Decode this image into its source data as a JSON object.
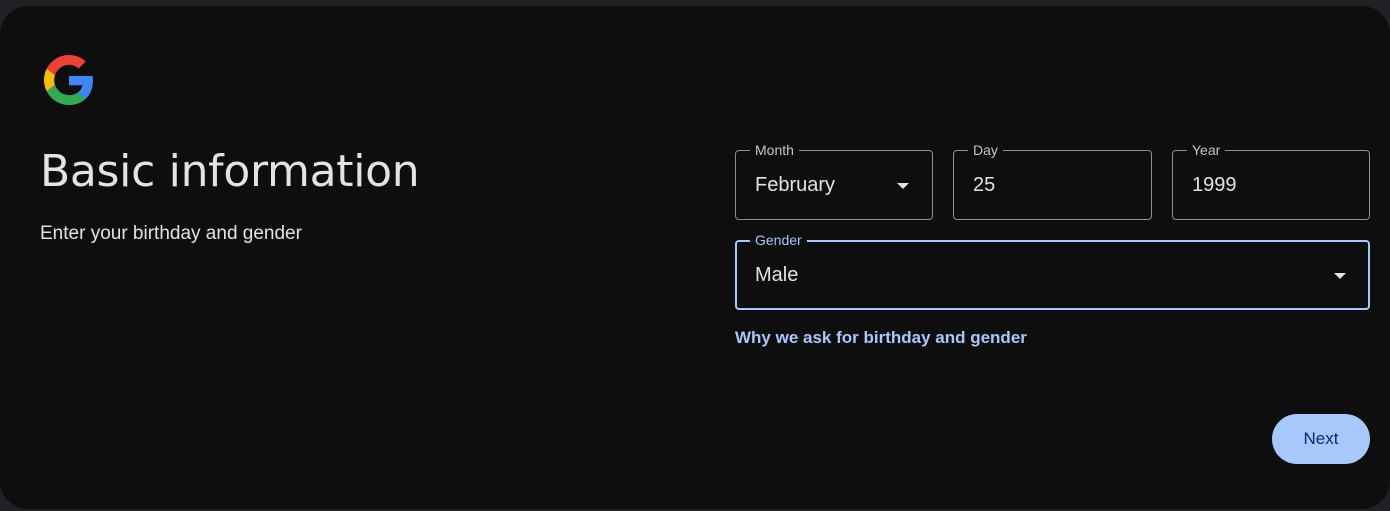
{
  "header": {
    "logo_icon": "google-g-logo"
  },
  "page": {
    "title": "Basic information",
    "subtitle": "Enter your birthday and gender"
  },
  "birthday": {
    "month": {
      "label": "Month",
      "value": "February",
      "icon": "dropdown-caret-icon"
    },
    "day": {
      "label": "Day",
      "value": "25"
    },
    "year": {
      "label": "Year",
      "value": "1999"
    }
  },
  "gender": {
    "label": "Gender",
    "value": "Male",
    "icon": "dropdown-caret-icon"
  },
  "links": {
    "why_ask": "Why we ask for birthday and gender"
  },
  "actions": {
    "next_label": "Next"
  },
  "colors": {
    "background": "#0e0e0f",
    "accent": "#a8c7fa",
    "text": "#e3e3e3",
    "button_text": "#062e6f"
  }
}
